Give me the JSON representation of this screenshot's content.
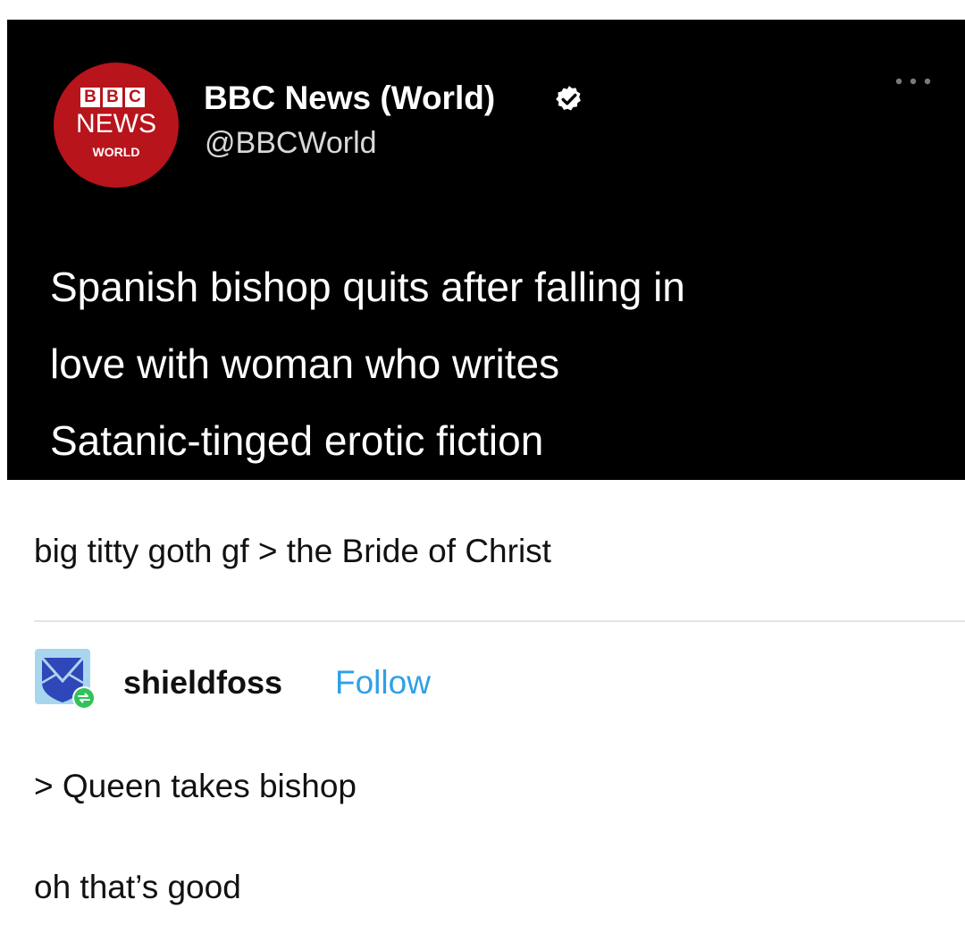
{
  "tweet": {
    "logo": {
      "blocks": [
        "B",
        "B",
        "C"
      ],
      "word": "NEWS",
      "region": "WORLD",
      "color": "#b8141c"
    },
    "account_name": "BBC News (World)",
    "verified_icon": "verified-badge-icon",
    "handle": "@BBCWorld",
    "more_icon": "more-options-icon",
    "headline_lines": [
      "Spanish bishop quits after falling in",
      "love with woman who writes",
      "Satanic-tinged erotic fiction"
    ]
  },
  "post": {
    "comment": "big titty goth gf > the Bride of Christ"
  },
  "reblog": {
    "avatar_icon": "envelope-shield-avatar-icon",
    "badge_icon": "reblog-icon",
    "username": "shieldfoss",
    "follow_label": "Follow",
    "follow_color": "#2fa0e6",
    "quote": "> Queen takes bishop",
    "reply": "oh that’s good"
  }
}
